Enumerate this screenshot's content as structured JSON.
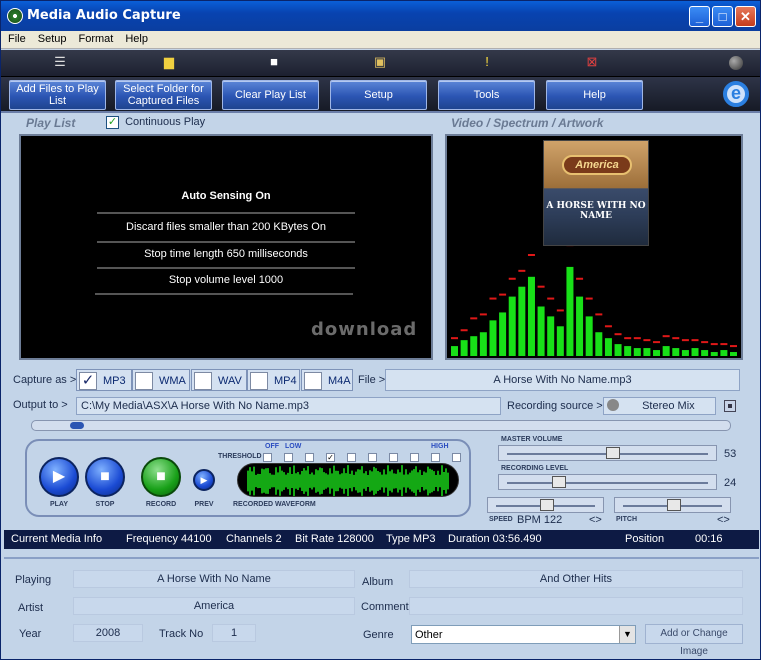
{
  "window": {
    "title": "Media Audio Capture"
  },
  "menu": [
    "File",
    "Setup",
    "Format",
    "Help"
  ],
  "toolbar_buttons": [
    {
      "label": "Add Files to Play List"
    },
    {
      "label": "Select Folder for Captured Files"
    },
    {
      "label": "Clear Play List"
    },
    {
      "label": "Setup"
    },
    {
      "label": "Tools"
    },
    {
      "label": "Help"
    }
  ],
  "playlist": {
    "section_label": "Play List",
    "continuous_play_label": "Continuous Play",
    "continuous_play_checked": true,
    "lines": [
      "Auto Sensing On",
      "Discard files smaller than 200 KBytes On",
      "Stop time length 650 milliseconds",
      "Stop volume level 1000"
    ]
  },
  "video": {
    "section_label": "Video / Spectrum / Artwork",
    "album_art_text": "A HORSE WITH NO NAME",
    "album_logo_text": "America",
    "spectrum_levels": [
      0.05,
      0.08,
      0.1,
      0.12,
      0.18,
      0.22,
      0.3,
      0.35,
      0.4,
      0.25,
      0.2,
      0.15,
      0.45,
      0.3,
      0.2,
      0.12,
      0.09,
      0.06,
      0.05,
      0.04,
      0.04,
      0.03,
      0.05,
      0.04,
      0.03,
      0.04,
      0.03,
      0.02,
      0.03,
      0.02
    ],
    "spectrum_peaks": [
      0.08,
      0.12,
      0.18,
      0.2,
      0.28,
      0.3,
      0.38,
      0.42,
      0.5,
      0.34,
      0.28,
      0.22,
      0.55,
      0.38,
      0.28,
      0.2,
      0.14,
      0.1,
      0.08,
      0.08,
      0.07,
      0.06,
      0.09,
      0.08,
      0.07,
      0.07,
      0.06,
      0.05,
      0.05,
      0.04
    ]
  },
  "watermark": "download",
  "capture": {
    "label": "Capture as >",
    "formats": [
      {
        "name": "MP3",
        "checked": true
      },
      {
        "name": "WMA",
        "checked": false
      },
      {
        "name": "WAV",
        "checked": false
      },
      {
        "name": "MP4",
        "checked": false
      },
      {
        "name": "M4A",
        "checked": false
      }
    ],
    "file_label": "File >",
    "file_value": "A Horse With No Name.mp3",
    "output_label": "Output to >",
    "output_value": "C:\\My Media\\ASX\\A Horse With No Name.mp3",
    "recording_source_label": "Recording source >",
    "recording_source_value": "Stereo Mix"
  },
  "transport": {
    "play": "PLAY",
    "stop": "STOP",
    "record": "RECORD",
    "prev": "PREV",
    "threshold_label": "THRESHOLD",
    "off_label": "OFF",
    "low_label": "LOW",
    "high_label": "HIGH",
    "waveform_label": "RECORDED WAVEFORM",
    "threshold_checked_index": 3
  },
  "mixer": {
    "master_label": "MASTER VOLUME",
    "master_value": "53",
    "master_level": 0.53,
    "recording_label": "RECORDING LEVEL",
    "recording_value": "24",
    "recording_level": 0.24,
    "speed_label": "SPEED",
    "bpm_label": "BPM 122",
    "speed_arrows": "<>",
    "pitch_label": "PITCH",
    "pitch_arrows": "<>"
  },
  "info_bar": {
    "current": "Current Media Info",
    "frequency": "Frequency 44100",
    "channels": "Channels 2",
    "bitrate": "Bit Rate 128000",
    "type": "Type MP3",
    "duration": "Duration 03:56.490",
    "position_label": "Position",
    "position_value": "00:16"
  },
  "meta": {
    "playing_label": "Playing",
    "playing_value": "A Horse With No Name",
    "artist_label": "Artist",
    "artist_value": "America",
    "year_label": "Year",
    "year_value": "2008",
    "track_label": "Track No",
    "track_value": "1",
    "album_label": "Album",
    "album_value": "And Other Hits",
    "comment_label": "Comment",
    "comment_value": "",
    "genre_label": "Genre",
    "genre_value": "Other",
    "change_image_label": "Add or Change Image"
  },
  "colors": {
    "accent": "#2b55b3",
    "spectrum_bar": "#18e018",
    "spectrum_peak": "#e01818",
    "waveform": "#1ae01a"
  }
}
